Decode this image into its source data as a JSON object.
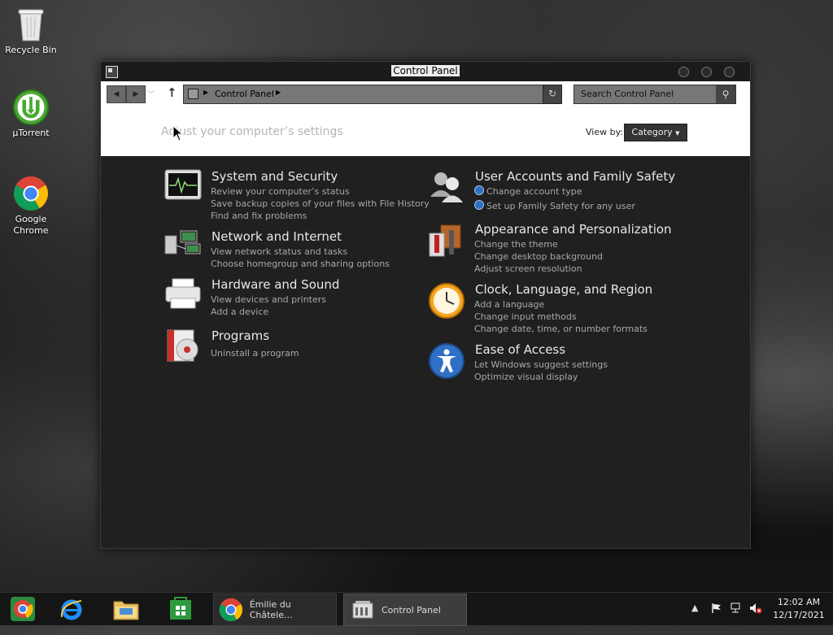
{
  "desktop": {
    "icons": [
      {
        "label": "Recycle Bin"
      },
      {
        "label": "µTorrent"
      },
      {
        "label": "Google Chrome"
      }
    ]
  },
  "window": {
    "title": "Control Panel",
    "address": {
      "crumb": "Control Panel"
    },
    "search": {
      "placeholder": "Search Control Panel"
    },
    "header": {
      "title": "Adjust your computer’s settings",
      "view_by_label": "View by:",
      "view_by_value": "Category"
    },
    "categories": [
      {
        "title": "System and Security",
        "links": [
          "Review your computer’s status",
          "Save backup copies of your files with File History",
          "Find and fix problems"
        ]
      },
      {
        "title": "Network and Internet",
        "links": [
          "View network status and tasks",
          "Choose homegroup and sharing options"
        ]
      },
      {
        "title": "Hardware and Sound",
        "links": [
          "View devices and printers",
          "Add a device"
        ]
      },
      {
        "title": "Programs",
        "links": [
          "Uninstall a program"
        ]
      },
      {
        "title": "User Accounts and Family Safety",
        "links": [
          "Change account type",
          "Set up Family Safety for any user"
        ]
      },
      {
        "title": "Appearance and Personalization",
        "links": [
          "Change the theme",
          "Change desktop background",
          "Adjust screen resolution"
        ]
      },
      {
        "title": "Clock, Language, and Region",
        "links": [
          "Add a language",
          "Change input methods",
          "Change date, time, or number formats"
        ]
      },
      {
        "title": "Ease of Access",
        "links": [
          "Let Windows suggest settings",
          "Optimize visual display"
        ]
      }
    ]
  },
  "taskbar": {
    "tasks": [
      {
        "label": "Émilie du Châtele..."
      },
      {
        "label": "Control Panel"
      }
    ],
    "clock": {
      "time": "12:02 AM",
      "date": "12/17/2021"
    }
  },
  "colors": {
    "accent_blue": "#2f6fc4",
    "window_bg": "#202020",
    "header_bg": "#ffffff"
  }
}
